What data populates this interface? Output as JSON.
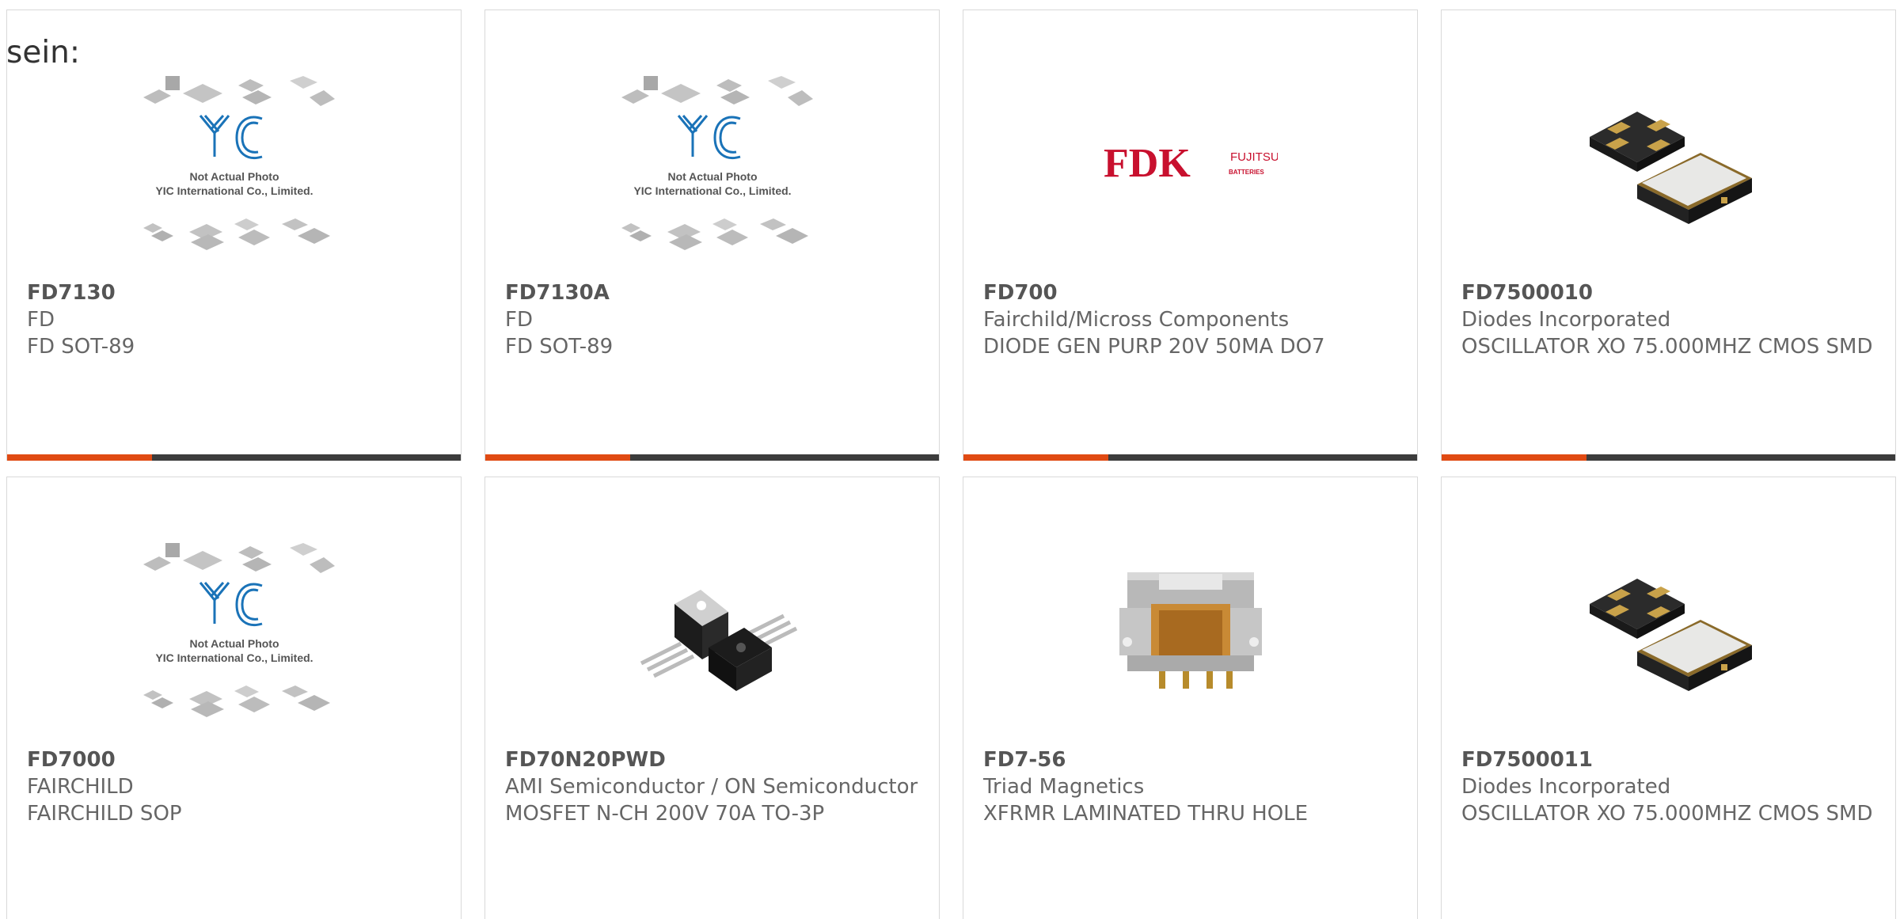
{
  "intro_text": "sein:",
  "placeholder": {
    "line1": "Not Actual Photo",
    "line2": "YIC International Co., Limited."
  },
  "fdk_logo": {
    "brand": "FDK",
    "sub1": "FUJITSU",
    "sub2": "BATTERIES"
  },
  "colors": {
    "accent": "#e04a13",
    "bar": "#3c3c3c",
    "yic_blue": "#1a73b8",
    "fdk_red": "#c8102e"
  },
  "products": [
    {
      "part_number": "FD7130",
      "manufacturer": "FD",
      "description": "FD SOT-89",
      "image": "placeholder"
    },
    {
      "part_number": "FD7130A",
      "manufacturer": "FD",
      "description": "FD SOT-89",
      "image": "placeholder"
    },
    {
      "part_number": "FD700",
      "manufacturer": "Fairchild/Micross Components",
      "description": "DIODE GEN PURP 20V 50MA DO7",
      "image": "fdk-logo"
    },
    {
      "part_number": "FD7500010",
      "manufacturer": "Diodes Incorporated",
      "description": "OSCILLATOR XO 75.000MHZ CMOS SMD",
      "image": "oscillator"
    },
    {
      "part_number": "FD7000",
      "manufacturer": "FAIRCHILD",
      "description": "FAIRCHILD SOP",
      "image": "placeholder"
    },
    {
      "part_number": "FD70N20PWD",
      "manufacturer": "AMI Semiconductor / ON Semiconductor",
      "description": "MOSFET N-CH 200V 70A TO-3P",
      "image": "mosfet"
    },
    {
      "part_number": "FD7-56",
      "manufacturer": "Triad Magnetics",
      "description": "XFRMR LAMINATED THRU HOLE",
      "image": "transformer"
    },
    {
      "part_number": "FD7500011",
      "manufacturer": "Diodes Incorporated",
      "description": "OSCILLATOR XO 75.000MHZ CMOS SMD",
      "image": "oscillator"
    }
  ]
}
